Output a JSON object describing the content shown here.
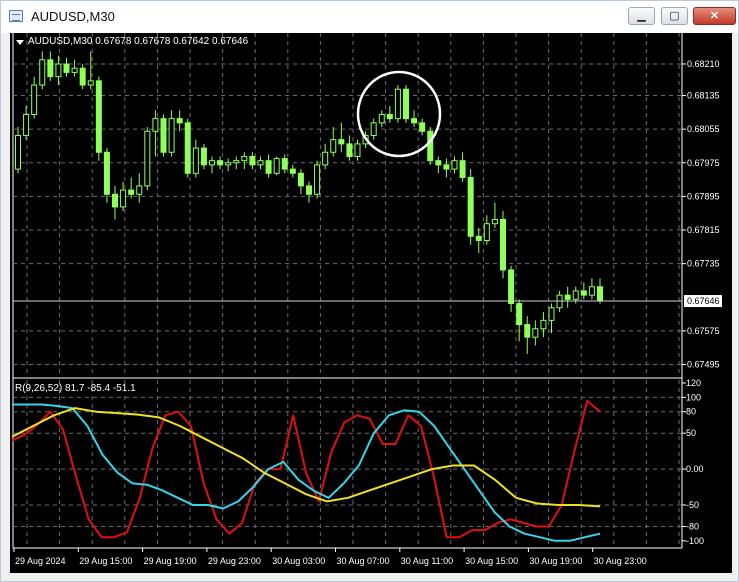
{
  "window": {
    "title": "AUDUSD,M30",
    "minimize_glyph": "▁",
    "maximize_glyph": "▢",
    "close_glyph": "✕"
  },
  "chart": {
    "header": "AUDUSD,M30  0.67678 0.67678 0.67642 0.67646",
    "indicator_header": "R(9,26,52) 81.7 -85.4 -51.1",
    "current_price": "0.67646",
    "price_ticks": [
      "0.68210",
      "0.68135",
      "0.68055",
      "0.67975",
      "0.67895",
      "0.67815",
      "0.67735",
      "0.67575",
      "0.67495"
    ],
    "indicator_ticks": [
      "120",
      "100",
      "80",
      "50",
      "0.00",
      "-50",
      "-80",
      "-100"
    ],
    "time_ticks": [
      "29 Aug 2024",
      "29 Aug 15:00",
      "29 Aug 19:00",
      "29 Aug 23:00",
      "30 Aug 03:00",
      "30 Aug 07:00",
      "30 Aug 11:00",
      "30 Aug 15:00",
      "30 Aug 19:00",
      "30 Aug 23:00"
    ],
    "colors": {
      "background": "#000000",
      "grid": "#6b6b6b",
      "candle": "#8fff5a",
      "fast": "#e01010",
      "mid": "#33d6e8",
      "slow": "#f0e020",
      "circle": "#ffffff"
    }
  },
  "chart_data": [
    {
      "type": "candlestick",
      "title": "AUDUSD,M30",
      "ylim": [
        0.6747,
        0.6826
      ],
      "candles": [
        [
          0.6796,
          0.6806,
          0.6795,
          0.6804
        ],
        [
          0.6804,
          0.6811,
          0.6803,
          0.6809
        ],
        [
          0.6809,
          0.6818,
          0.6808,
          0.6816
        ],
        [
          0.6816,
          0.6824,
          0.6815,
          0.6822
        ],
        [
          0.6822,
          0.6824,
          0.6817,
          0.6818
        ],
        [
          0.6818,
          0.6823,
          0.6816,
          0.6821
        ],
        [
          0.6821,
          0.68225,
          0.6818,
          0.6819
        ],
        [
          0.6819,
          0.6822,
          0.6818,
          0.682
        ],
        [
          0.682,
          0.6821,
          0.6815,
          0.6816
        ],
        [
          0.6816,
          0.6824,
          0.6815,
          0.6817
        ],
        [
          0.6817,
          0.6818,
          0.6798,
          0.68
        ],
        [
          0.68,
          0.6801,
          0.6788,
          0.679
        ],
        [
          0.679,
          0.6792,
          0.6784,
          0.6787
        ],
        [
          0.6787,
          0.6793,
          0.6786,
          0.6791
        ],
        [
          0.6791,
          0.6794,
          0.6789,
          0.679
        ],
        [
          0.679,
          0.6795,
          0.6788,
          0.6792
        ],
        [
          0.6792,
          0.6806,
          0.6791,
          0.6805
        ],
        [
          0.6805,
          0.681,
          0.6799,
          0.6808
        ],
        [
          0.6808,
          0.6809,
          0.6799,
          0.68
        ],
        [
          0.68,
          0.681,
          0.6799,
          0.6808
        ],
        [
          0.6808,
          0.681,
          0.6805,
          0.6807
        ],
        [
          0.6807,
          0.6808,
          0.6794,
          0.6795
        ],
        [
          0.6795,
          0.6803,
          0.6794,
          0.6801
        ],
        [
          0.6801,
          0.6802,
          0.6796,
          0.6797
        ],
        [
          0.6797,
          0.6799,
          0.6795,
          0.6798
        ],
        [
          0.6798,
          0.6799,
          0.6796,
          0.6797
        ],
        [
          0.6797,
          0.67985,
          0.67955,
          0.67975
        ],
        [
          0.67975,
          0.6799,
          0.6796,
          0.6798
        ],
        [
          0.6798,
          0.68,
          0.6796,
          0.6799
        ],
        [
          0.6799,
          0.68,
          0.6796,
          0.6797
        ],
        [
          0.6797,
          0.6799,
          0.6796,
          0.6798
        ],
        [
          0.6798,
          0.67995,
          0.6794,
          0.6795
        ],
        [
          0.6795,
          0.6799,
          0.67945,
          0.67985
        ],
        [
          0.67985,
          0.67995,
          0.6795,
          0.6796
        ],
        [
          0.6796,
          0.6797,
          0.6794,
          0.6795
        ],
        [
          0.6795,
          0.6796,
          0.679,
          0.6792
        ],
        [
          0.6792,
          0.6793,
          0.6788,
          0.679
        ],
        [
          0.679,
          0.6798,
          0.6789,
          0.6797
        ],
        [
          0.6797,
          0.6802,
          0.6796,
          0.68
        ],
        [
          0.68,
          0.6806,
          0.6799,
          0.6803
        ],
        [
          0.6803,
          0.6807,
          0.68,
          0.6802
        ],
        [
          0.6802,
          0.6804,
          0.6798,
          0.6799
        ],
        [
          0.6799,
          0.6803,
          0.6798,
          0.6802
        ],
        [
          0.6802,
          0.6805,
          0.6801,
          0.6804
        ],
        [
          0.6804,
          0.6808,
          0.6803,
          0.6807
        ],
        [
          0.6807,
          0.681,
          0.6806,
          0.6809
        ],
        [
          0.6809,
          0.6811,
          0.6807,
          0.6808
        ],
        [
          0.6808,
          0.6816,
          0.6807,
          0.6815
        ],
        [
          0.6815,
          0.6816,
          0.6807,
          0.6808
        ],
        [
          0.6808,
          0.681,
          0.6806,
          0.6807
        ],
        [
          0.6807,
          0.6808,
          0.6804,
          0.6805
        ],
        [
          0.6805,
          0.6806,
          0.6797,
          0.6798
        ],
        [
          0.6798,
          0.6799,
          0.6795,
          0.6797
        ],
        [
          0.6797,
          0.67985,
          0.6794,
          0.6796
        ],
        [
          0.6796,
          0.6799,
          0.6795,
          0.6798
        ],
        [
          0.6798,
          0.68,
          0.6793,
          0.6794
        ],
        [
          0.6794,
          0.6796,
          0.6778,
          0.678
        ],
        [
          0.678,
          0.6782,
          0.6776,
          0.6779
        ],
        [
          0.6779,
          0.6785,
          0.6778,
          0.6783
        ],
        [
          0.6783,
          0.6788,
          0.6782,
          0.6784
        ],
        [
          0.6784,
          0.6786,
          0.677,
          0.6772
        ],
        [
          0.6772,
          0.6773,
          0.6762,
          0.6764
        ],
        [
          0.6764,
          0.6765,
          0.6755,
          0.6759
        ],
        [
          0.6759,
          0.6761,
          0.6752,
          0.6756
        ],
        [
          0.6756,
          0.676,
          0.6754,
          0.6758
        ],
        [
          0.6758,
          0.6762,
          0.6756,
          0.676
        ],
        [
          0.676,
          0.6764,
          0.6757,
          0.6763
        ],
        [
          0.6763,
          0.6767,
          0.6762,
          0.6766
        ],
        [
          0.6766,
          0.6768,
          0.6763,
          0.6765
        ],
        [
          0.6765,
          0.6768,
          0.6764,
          0.6767
        ],
        [
          0.6767,
          0.6769,
          0.6765,
          0.6766
        ],
        [
          0.6766,
          0.677,
          0.6765,
          0.6768
        ],
        [
          0.6768,
          0.677,
          0.6764,
          0.67646
        ]
      ]
    },
    {
      "type": "line",
      "title": "R(9,26,52)",
      "ylim": [
        -110,
        120
      ],
      "series": [
        {
          "name": "fast",
          "values": [
            40,
            48,
            62,
            80,
            55,
            -10,
            -70,
            -95,
            -95,
            -88,
            -40,
            30,
            75,
            80,
            60,
            -20,
            -70,
            -90,
            -75,
            -20,
            0,
            0,
            75,
            -5,
            -45,
            25,
            65,
            75,
            70,
            35,
            35,
            75,
            60,
            -10,
            -95,
            -95,
            -85,
            -85,
            -75,
            -70,
            -75,
            -80,
            -80,
            -50,
            25,
            95,
            80
          ]
        },
        {
          "name": "mid",
          "values": [
            90,
            90,
            90,
            88,
            85,
            60,
            20,
            -5,
            -20,
            -22,
            -30,
            -40,
            -50,
            -50,
            -55,
            -45,
            -25,
            0,
            10,
            -15,
            -30,
            -40,
            -20,
            5,
            50,
            75,
            82,
            80,
            60,
            30,
            0,
            -30,
            -60,
            -80,
            -90,
            -95,
            -100,
            -100,
            -95,
            -90
          ]
        },
        {
          "name": "slow",
          "values": [
            45,
            60,
            75,
            85,
            80,
            78,
            76,
            72,
            60,
            45,
            30,
            15,
            -5,
            -20,
            -35,
            -45,
            -40,
            -30,
            -20,
            -10,
            0,
            5,
            5,
            -15,
            -40,
            -48,
            -50,
            -50,
            -52
          ]
        }
      ]
    }
  ]
}
